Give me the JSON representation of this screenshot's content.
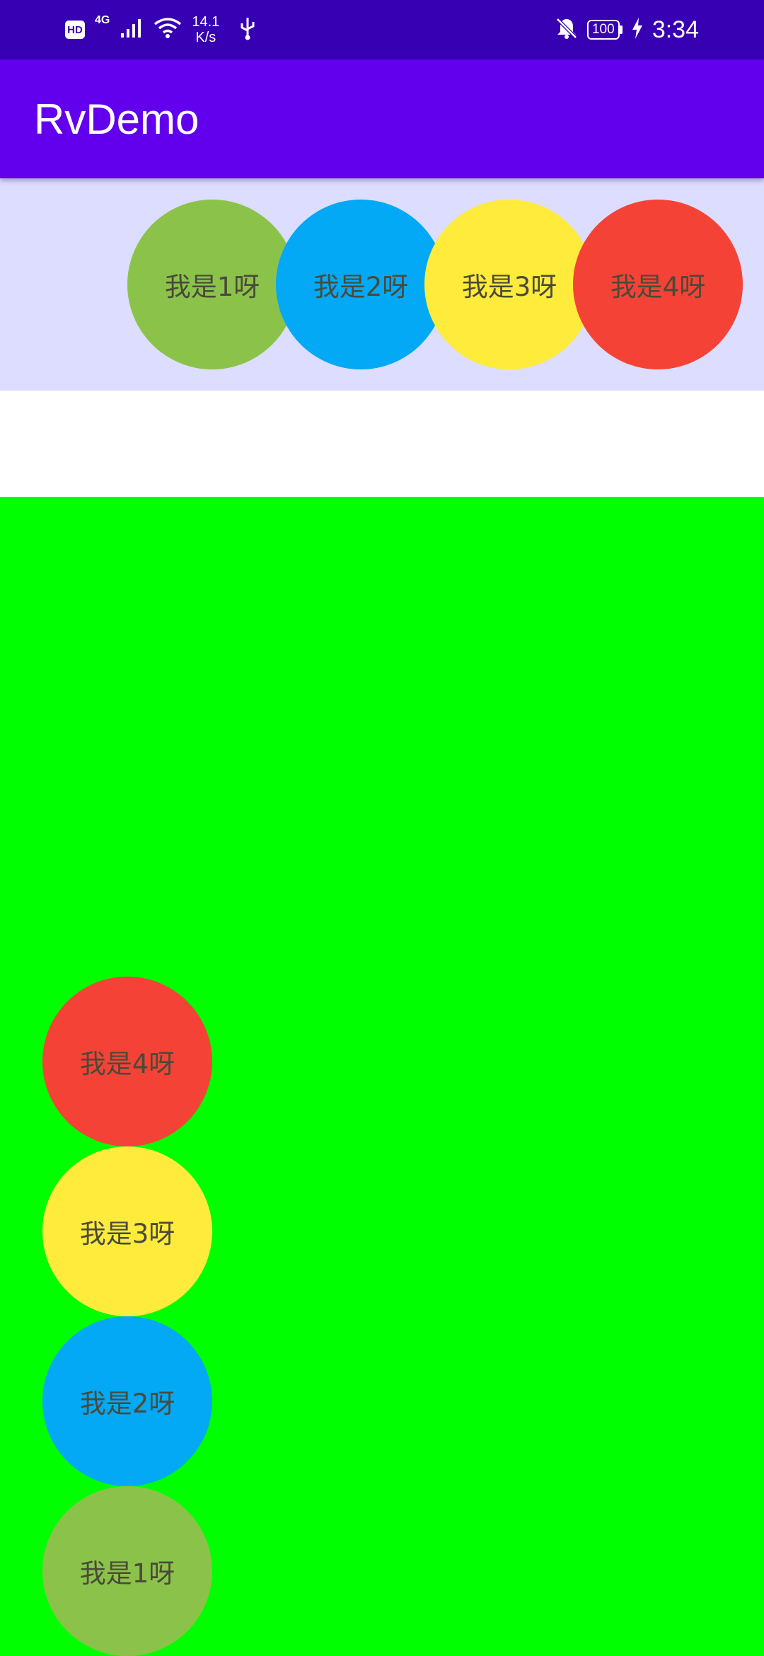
{
  "status_bar": {
    "hd": "HD",
    "network": "4G",
    "speed_value": "14.1",
    "speed_unit": "K/s",
    "battery": "100",
    "time": "3:34",
    "icons": [
      "hd-icon",
      "signal-icon",
      "wifi-icon",
      "usb-icon",
      "bell-off-icon",
      "battery-icon",
      "charging-icon"
    ]
  },
  "app_bar": {
    "title": "RvDemo"
  },
  "horizontal_list": {
    "items": [
      {
        "label": "我是1呀",
        "color": "#8BC34A"
      },
      {
        "label": "我是2呀",
        "color": "#03A9F4"
      },
      {
        "label": "我是3呀",
        "color": "#FFEB3B"
      },
      {
        "label": "我是4呀",
        "color": "#F44336"
      }
    ]
  },
  "vertical_list": {
    "items": [
      {
        "label": "我是4呀",
        "color": "#F44336"
      },
      {
        "label": "我是3呀",
        "color": "#FFEB3B"
      },
      {
        "label": "我是2呀",
        "color": "#03A9F4"
      },
      {
        "label": "我是1呀",
        "color": "#8BC34A"
      }
    ]
  },
  "colors": {
    "status_bar": "#3700B3",
    "app_bar": "#6200EE",
    "horizontal_bg": "#DDDDFF",
    "vertical_bg": "#00FF00"
  }
}
